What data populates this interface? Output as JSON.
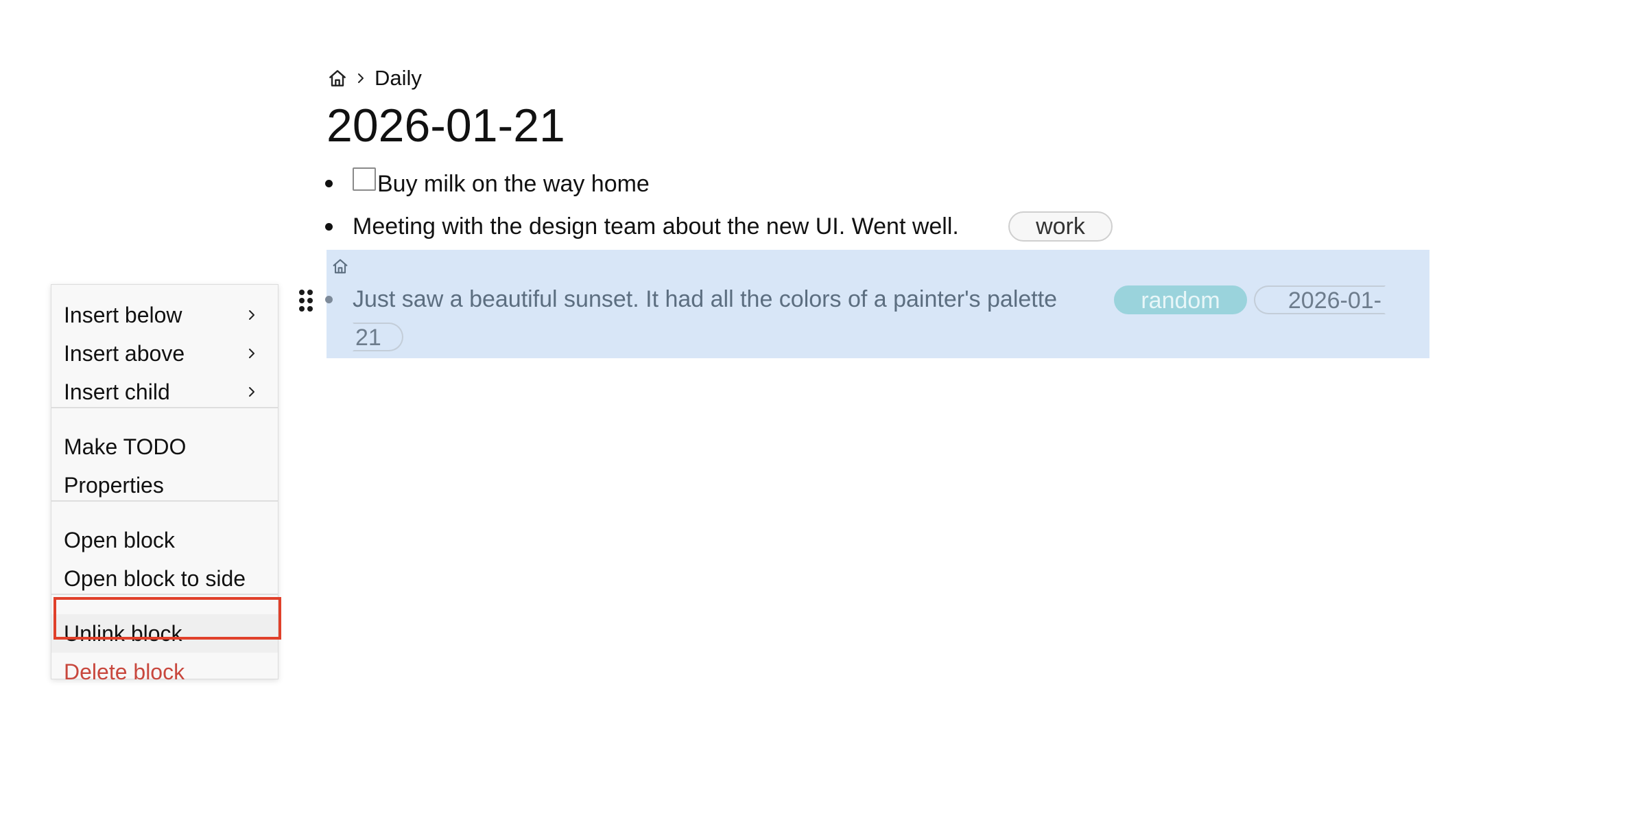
{
  "breadcrumb": {
    "items": [
      "Daily"
    ]
  },
  "page": {
    "title": "2026-01-21"
  },
  "blocks": [
    {
      "text": "Buy milk on the way home",
      "todo": true,
      "checked": false
    },
    {
      "text": "Meeting with the design team about the new UI. Went well.",
      "tags": [
        "work"
      ]
    },
    {
      "text": "Just saw a beautiful sunset. It had all the colors of a painter's palette",
      "tags": [
        "random",
        "2026-01-",
        "21"
      ],
      "selected": true
    }
  ],
  "context_menu": {
    "insert_below": "Insert below",
    "insert_above": "Insert above",
    "insert_child": "Insert child",
    "make_todo": "Make TODO",
    "properties": "Properties",
    "open_block": "Open block",
    "open_block_to_side": "Open block to side",
    "unlink_block": "Unlink block",
    "delete_block": "Delete block"
  },
  "colors": {
    "selection_background": "#d8e6f7",
    "random_tag": "#9ad3dc",
    "danger_text": "#c8473d",
    "highlight_outline": "#e0402a",
    "muted_text": "#5c6e80"
  }
}
